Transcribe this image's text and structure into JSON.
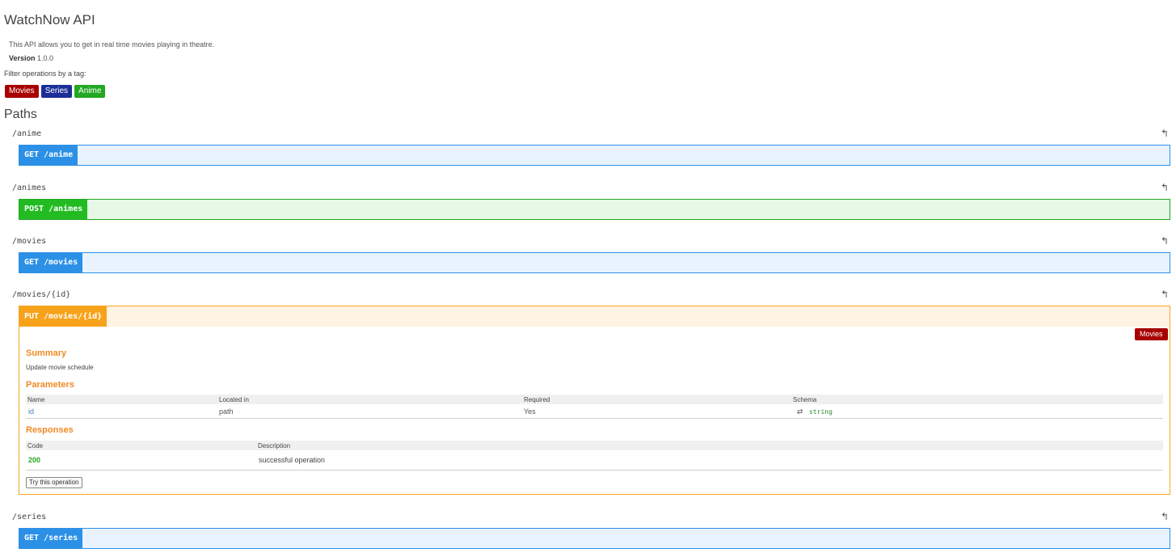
{
  "api": {
    "title": "WatchNow API",
    "description": "This API allows you to get in real time movies playing in theatre.",
    "version_label": "Version",
    "version": "1.0.0",
    "filter_label": "Filter operations by a tag:"
  },
  "tags": [
    {
      "label": "Movies",
      "color": "#a80000"
    },
    {
      "label": "Series",
      "color": "#1c2f97"
    },
    {
      "label": "Anime",
      "color": "#22a822"
    }
  ],
  "paths_heading": "Paths",
  "paths": [
    {
      "name": "/anime",
      "operation": "GET /anime",
      "method": "get"
    },
    {
      "name": "/animes",
      "operation": "POST /animes",
      "method": "post"
    },
    {
      "name": "/movies",
      "operation": "GET /movies",
      "method": "get"
    },
    {
      "name": "/movies/{id}",
      "operation": "PUT /movies/{id}",
      "method": "put"
    },
    {
      "name": "/series",
      "operation": "GET /series",
      "method": "get"
    }
  ],
  "put_detail": {
    "tag": "Movies",
    "summary_heading": "Summary",
    "summary": "Update movie schedule",
    "parameters_heading": "Parameters",
    "param_headers": [
      "Name",
      "Located in",
      "Required",
      "Schema"
    ],
    "param_row": {
      "name": "id",
      "located_in": "path",
      "required": "Yes",
      "schema_icon": "⇄",
      "schema": "string"
    },
    "responses_heading": "Responses",
    "resp_headers": [
      "Code",
      "Description"
    ],
    "resp_row": {
      "code": "200",
      "description": "successful operation"
    },
    "try_button": "Try this operation"
  },
  "colors": {
    "get": "#2b90e6",
    "post": "#22bb22",
    "put": "#f7a21b",
    "heading": "#f08a24"
  }
}
